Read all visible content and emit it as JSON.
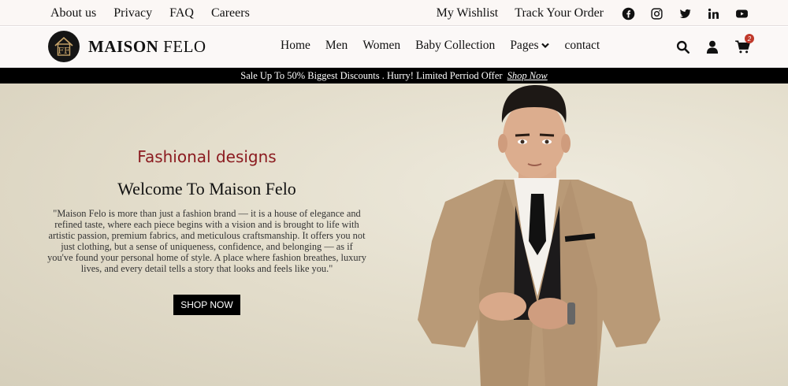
{
  "topbar": {
    "left_links": [
      "About us",
      "Privacy",
      "FAQ",
      "Careers"
    ],
    "wishlist": "My Wishlist",
    "track_order": "Track Your Order",
    "social_icons": [
      "facebook-icon",
      "instagram-icon",
      "twitter-icon",
      "linkedin-icon",
      "youtube-icon"
    ]
  },
  "navbar": {
    "logo_bold": "MAISON",
    "logo_light": "FELO",
    "links": [
      "Home",
      "Men",
      "Women",
      "Baby Collection",
      "Pages",
      "contact"
    ],
    "cart_count": "2"
  },
  "promo": {
    "text": "Sale Up To 50% Biggest Discounts . Hurry! Limited Perriod Offer",
    "link": "Shop Now"
  },
  "hero": {
    "title": "Fashional designs",
    "welcome": "Welcome To Maison Felo",
    "description": "\"Maison Felo is more than just a fashion brand — it is a house of elegance and refined taste, where each piece begins with a vision and is brought to life with artistic passion, premium fabrics, and meticulous craftsmanship. It offers you not just clothing, but a sense of uniqueness, confidence, and belonging — as if you've found your personal home of style. A place where fashion breathes, luxury lives, and every detail tells a story that looks and feels like you.\"",
    "button": "SHOP NOW"
  },
  "colors": {
    "accent_red": "#8b1a1f",
    "promo_bg": "#000000",
    "hero_bg": "#e3ddcb",
    "badge": "#c0392b"
  }
}
